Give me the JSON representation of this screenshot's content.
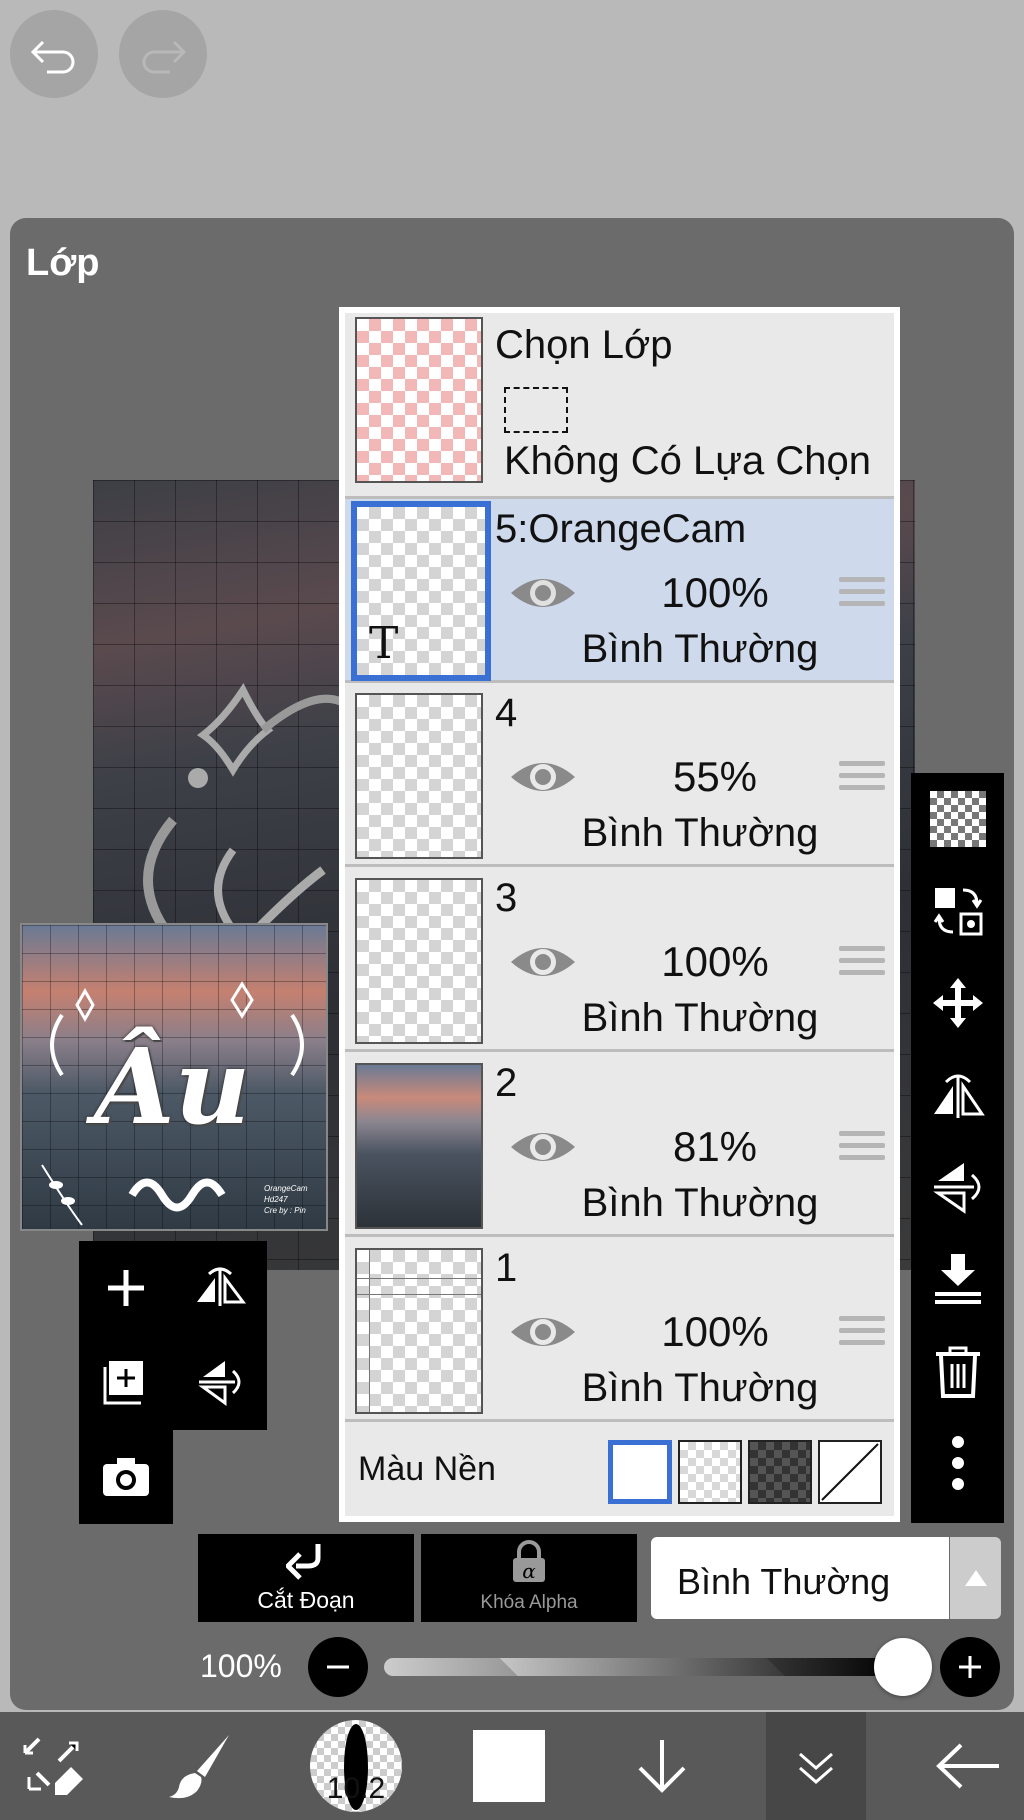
{
  "panel": {
    "title": "Lớp"
  },
  "layers": [
    {
      "id": "selection",
      "name": "Chọn Lớp",
      "sub": "Không Có Lựa Chọn"
    },
    {
      "id": "5",
      "name": "5:OrangeCam",
      "opacity": "100%",
      "blend": "Bình Thường",
      "selected": true,
      "type": "text"
    },
    {
      "id": "4",
      "name": "4",
      "opacity": "55%",
      "blend": "Bình Thường"
    },
    {
      "id": "3",
      "name": "3",
      "opacity": "100%",
      "blend": "Bình Thường"
    },
    {
      "id": "2",
      "name": "2",
      "opacity": "81%",
      "blend": "Bình Thường"
    },
    {
      "id": "1",
      "name": "1",
      "opacity": "100%",
      "blend": "Bình Thường"
    }
  ],
  "background": {
    "label": "Màu Nền",
    "selected": "white"
  },
  "thumb": {
    "title": "Âu",
    "small1": "OrangeCam",
    "small2": "Hd247",
    "small3": "Cre by : Pin"
  },
  "actions": {
    "clip_label": "Cắt Đoạn",
    "alpha_label": "Khóa Alpha",
    "blend_mode": "Bình Thường"
  },
  "opacity_slider": {
    "label": "100%",
    "value": 1.0
  },
  "brush": {
    "size": "10.2"
  },
  "colors": {
    "accent": "#3a6fd4",
    "selected_row": "#cfd9ec",
    "panel": "#6b6b6b"
  }
}
